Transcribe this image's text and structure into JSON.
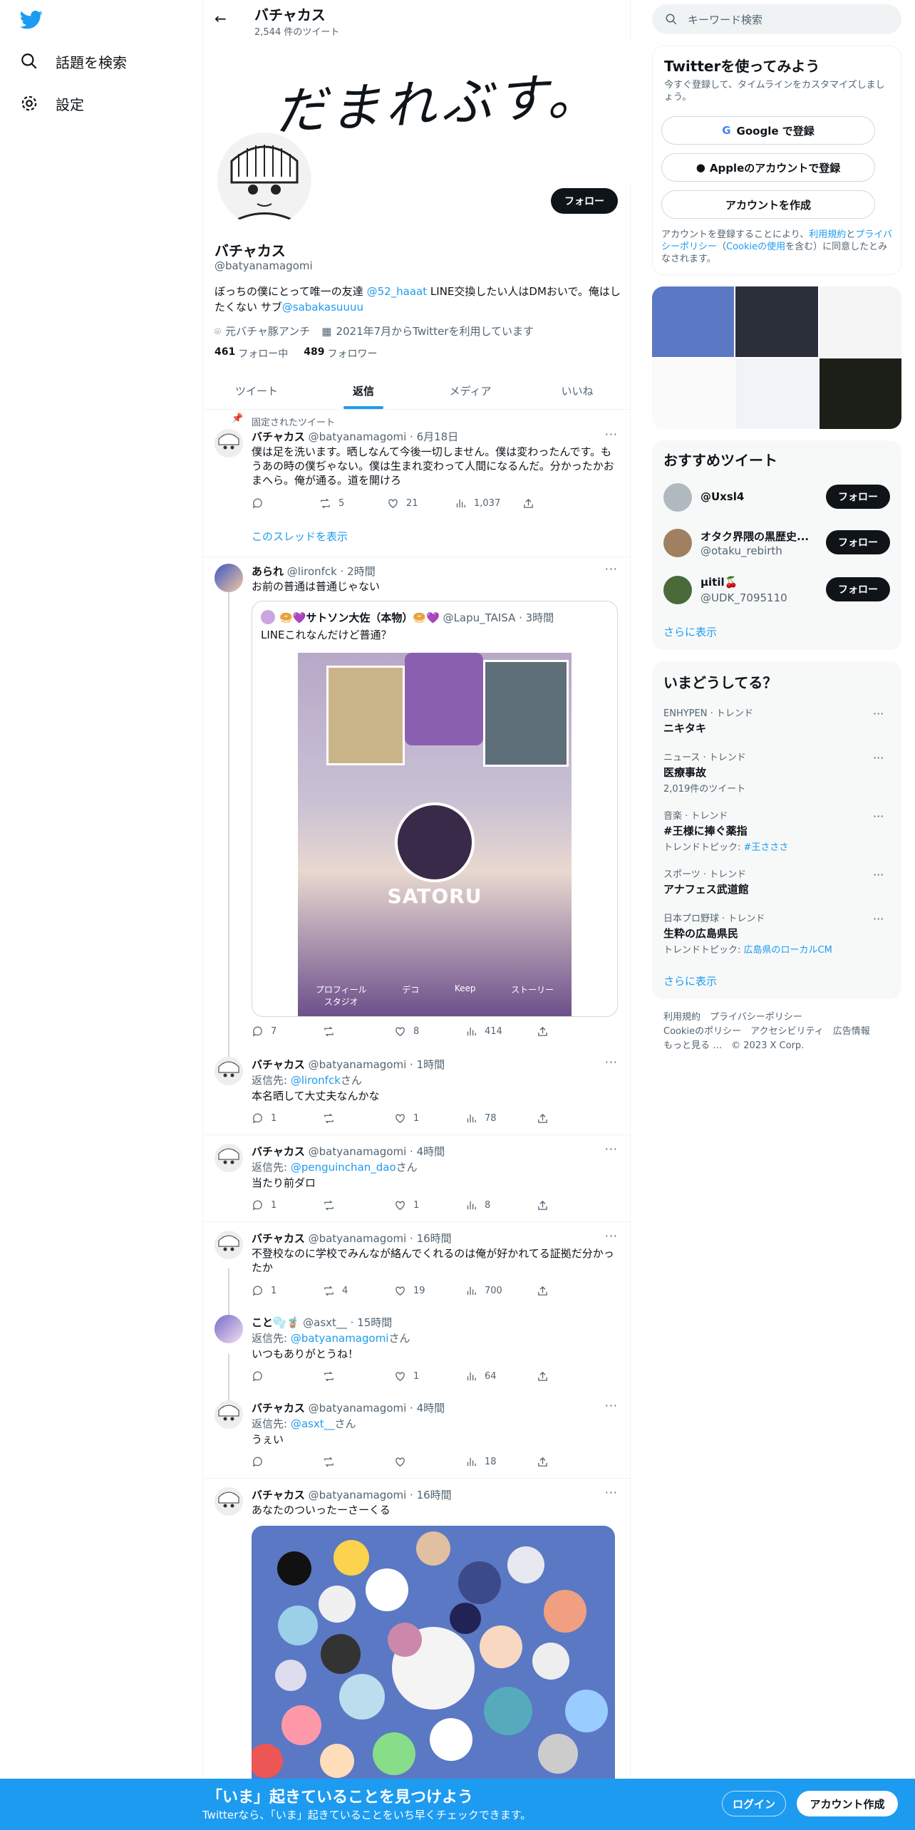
{
  "nav": {
    "explore": "話題を検索",
    "settings": "設定"
  },
  "profile_header": {
    "name": "バチャカス",
    "tweet_count": "2,544 件のツイート"
  },
  "banner_text": "だまれぶす。",
  "profile": {
    "name": "バチャカス",
    "handle": "@batyanamagomi",
    "follow_label": "フォロー",
    "bio_pre": "ぼっちの僕にとって唯一の友達 ",
    "bio_mention1": "@52_haaat",
    "bio_mid": " LINE交換したい人はDMおいで。俺はしたくない  サブ",
    "bio_mention2": "@sabakasuuuu",
    "location": "元バチャ豚アンチ",
    "joined": "2021年7月からTwitterを利用しています",
    "following_count": "461",
    "following_label": "フォロー中",
    "followers_count": "489",
    "followers_label": "フォロワー"
  },
  "tabs": [
    "ツイート",
    "返信",
    "メディア",
    "いいね"
  ],
  "active_tab": "返信",
  "tweets": {
    "pinned": {
      "pinned_label": "固定されたツイート",
      "name": "バチャカス",
      "meta": "@batyanamagomi · 6月18日",
      "text": "僕は足を洗います。晒しなんて今後一切しません。僕は変わったんです。もうあの時の僕ぢゃない。僕は生まれ変わって人間になるんだ。分かったかおまへら。俺が通る。道を開けろ",
      "retweets": "5",
      "likes": "21",
      "views": "1,037",
      "thread_link": "このスレッドを表示"
    },
    "arare": {
      "name": "あられ",
      "meta": "@lironfck · 2時間",
      "text": "お前の普通は普通じゃない",
      "replies": "7",
      "likes": "8",
      "views": "414",
      "quote": {
        "name": "サトソン大佐（本物）",
        "meta": "@Lapu_TAISA · 3時間",
        "text": "LINEこれなんだけど普通？",
        "image_name": "SATORU",
        "image_labels": [
          "プロフィール\nスタジオ",
          "デコ",
          "Keep",
          "ストーリー"
        ]
      }
    },
    "r1": {
      "name": "バチャカス",
      "meta": "@batyanamagomi · 1時間",
      "reply_to_label": "返信先: ",
      "reply_to": "@lironfck",
      "reply_suffix": "さん",
      "text": "本名晒して大丈夫なんかな",
      "replies": "1",
      "likes": "1",
      "views": "78"
    },
    "r2": {
      "name": "バチャカス",
      "meta": "@batyanamagomi · 4時間",
      "reply_to_label": "返信先: ",
      "reply_to": "@penguinchan_dao",
      "reply_suffix": "さん",
      "text": "当たり前ダロ",
      "replies": "1",
      "likes": "1",
      "views": "8"
    },
    "r3": {
      "name": "バチャカス",
      "meta": "@batyanamagomi · 16時間",
      "text": "不登校なのに学校でみんなが絡んでくれるのは俺が好かれてる証拠だ分かったか",
      "replies": "1",
      "retweets": "4",
      "likes": "19",
      "views": "700"
    },
    "r4": {
      "name": "こと🫧🧋",
      "meta": "@asxt__ · 15時間",
      "reply_to_label": "返信先: ",
      "reply_to": "@batyanamagomi",
      "reply_suffix": "さん",
      "text": "いつもありがとうね！",
      "likes": "1",
      "views": "64"
    },
    "r5": {
      "name": "バチャカス",
      "meta": "@batyanamagomi · 4時間",
      "reply_to_label": "返信先: ",
      "reply_to": "@asxt__",
      "reply_suffix": "さん",
      "text": "うぇい",
      "views": "18"
    },
    "r6": {
      "name": "バチャカス",
      "meta": "@batyanamagomi · 16時間",
      "text": "あなたのついったーさーくる"
    }
  },
  "search_placeholder": "キーワード検索",
  "signup": {
    "title": "Twitterを使ってみよう",
    "subtitle": "今すぐ登録して、タイムラインをカスタマイズしましょう。",
    "google": "Google で登録",
    "apple": "Appleのアカウントで登録",
    "create": "アカウントを作成",
    "legal_1": "アカウントを登録することにより、",
    "legal_terms": "利用規約",
    "legal_2": "と",
    "legal_privacy": "プライバシーポリシー",
    "legal_3": "（",
    "legal_cookie": "Cookieの使用",
    "legal_4": "を含む）に同意したとみなされます。"
  },
  "who_to_follow": {
    "title": "おすすめツイート",
    "users": [
      {
        "name": "@Uxsl4",
        "handle": "",
        "button": "フォロー"
      },
      {
        "name": "オタク界隈の黒歴史...",
        "handle": "@otaku_rebirth",
        "button": "フォロー"
      },
      {
        "name": "µitil🍒",
        "handle": "@UDK_7095110",
        "button": "フォロー"
      }
    ],
    "more": "さらに表示"
  },
  "trends": {
    "title": "いまどうしてる？",
    "items": [
      {
        "meta": "ENHYPEN · トレンド",
        "name": "ニキタキ",
        "extra": "",
        "extra_link": ""
      },
      {
        "meta": "ニュース · トレンド",
        "name": "医療事故",
        "extra": "2,019件のツイート",
        "extra_link": ""
      },
      {
        "meta": "音楽 · トレンド",
        "name": "#王様に捧ぐ薬指",
        "extra": "トレンドトピック: ",
        "extra_link": "#王さささ"
      },
      {
        "meta": "スポーツ · トレンド",
        "name": "アナフェス武道館",
        "extra": "",
        "extra_link": ""
      },
      {
        "meta": "日本プロ野球 · トレンド",
        "name": "生粋の広島県民",
        "extra": "トレンドトピック: ",
        "extra_link": "広島県のローカルCM"
      }
    ],
    "more": "さらに表示"
  },
  "footer": {
    "links1": [
      "利用規約",
      "プライバシーポリシー"
    ],
    "links2": [
      "Cookieのポリシー",
      "アクセシビリティ",
      "広告情報"
    ],
    "more": "もっと見る …",
    "copyright": "© 2023 X Corp."
  },
  "bottom_bar": {
    "title": "「いま」起きていることを見つけよう",
    "subtitle": "Twitterなら、「いま」起きていることをいち早くチェックできます。",
    "login": "ログイン",
    "signup": "アカウント作成"
  },
  "colors": {
    "accent": "#1d9bf0",
    "bottom_bar": "#1d9bf0"
  }
}
